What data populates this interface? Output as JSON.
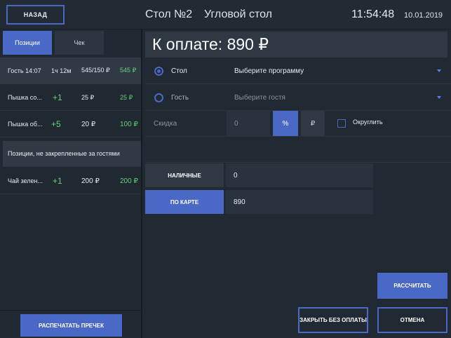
{
  "header": {
    "back_label": "НАЗАД",
    "table_title": "Стол №2",
    "table_name": "Угловой стол",
    "time": "11:54:48",
    "date": "10.01.2019"
  },
  "left": {
    "tabs": [
      {
        "label": "Позиции",
        "active": true
      },
      {
        "label": "Чек",
        "active": false
      }
    ],
    "guest_row": {
      "name": "Гость 14:07",
      "duration": "1ч 12м",
      "ratio": "545/150 ₽",
      "total": "545 ₽"
    },
    "items": [
      {
        "name": "Пышка со...",
        "qty": "+1",
        "price": "25 ₽",
        "total": "25 ₽"
      },
      {
        "name": "Пышка об...",
        "qty": "+5",
        "price": "20 ₽",
        "total": "100 ₽"
      }
    ],
    "unassigned_label": "Позиции, не закрепленные за гостями",
    "unassigned_items": [
      {
        "name": "Чай зелен...",
        "qty": "+1",
        "price": "200 ₽",
        "total": "200 ₽"
      }
    ],
    "print_label": "РАСПЕЧАТАТЬ ПРЕЧЕК"
  },
  "right": {
    "amount": "К оплате: 890 ₽",
    "table_option": {
      "label": "Стол",
      "selected": true,
      "select_placeholder": "Выберите программу"
    },
    "guest_option": {
      "label": "Гость",
      "selected": false,
      "select_placeholder": "Выберите гостя"
    },
    "discount": {
      "label": "Скидка",
      "value": "0",
      "percent_label": "%",
      "rub_label": "₽",
      "round_label": "Округлить"
    },
    "payments": {
      "cash_label": "НАЛИЧНЫЕ",
      "cash_value": "0",
      "card_label": "ПО КАРТЕ",
      "card_value": "890"
    },
    "calc_label": "РАССЧИТАТЬ",
    "close_nopay_label": "ЗАКРЫТЬ БЕЗ ОПЛАТЫ",
    "cancel_label": "ОТМЕНА"
  },
  "colors": {
    "accent": "#4a69c7",
    "positive": "#66d17a",
    "background": "#212a33"
  }
}
